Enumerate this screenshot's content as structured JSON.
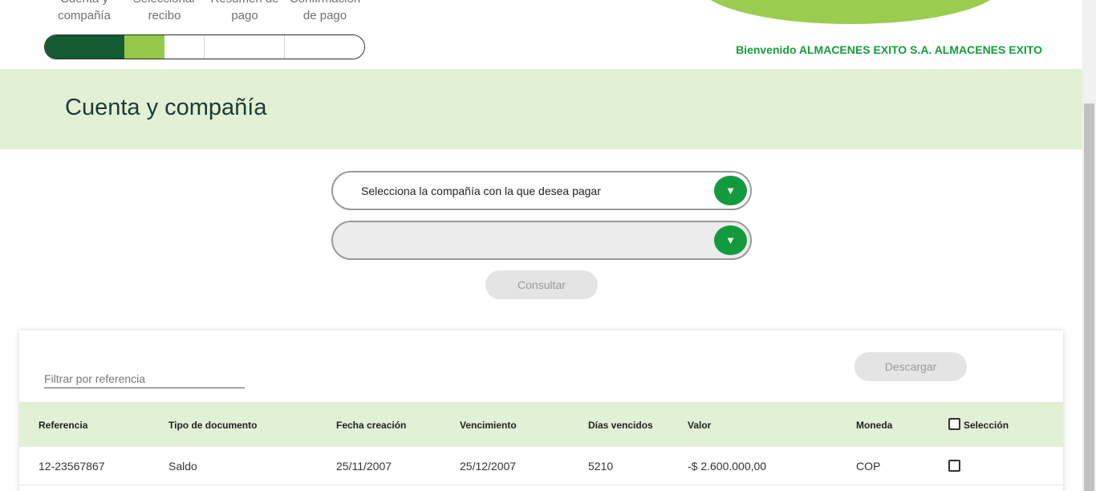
{
  "steps": [
    {
      "label": "Cuenta y compañía"
    },
    {
      "label": "Seleccionar recibo"
    },
    {
      "label": "Resumen de pago"
    },
    {
      "label": "Confirmación de pago"
    }
  ],
  "progress": {
    "completed_steps": 1,
    "active_step": 2,
    "total_steps": 4
  },
  "header": {
    "welcome": "Bienvenido ALMACENES EXITO S.A. ALMACENES EXITO"
  },
  "page_title": "Cuenta y compañía",
  "form": {
    "company_select": {
      "value": "Selecciona la compañía con la que desea pagar"
    },
    "account_select": {
      "value": ""
    },
    "consult_label": "Consultar"
  },
  "table_card": {
    "filter_placeholder": "Filtrar por referencia",
    "download_label": "Descargar",
    "columns": {
      "referencia": "Referencia",
      "tipo": "Tipo de documento",
      "fecha": "Fecha creación",
      "vencimiento": "Vencimiento",
      "dias": "Días vencidos",
      "valor": "Valor",
      "moneda": "Moneda",
      "seleccion": "Selección"
    },
    "rows": [
      {
        "referencia": "12-23567867",
        "tipo": "Saldo",
        "fecha": "25/11/2007",
        "vencimiento": "25/12/2007",
        "dias": "5210",
        "valor": "-$ 2.600.000,00",
        "moneda": "COP",
        "selected": false
      }
    ]
  },
  "icons": {
    "dropdown": "▼"
  },
  "colors": {
    "brand_dark_green": "#145a32",
    "brand_light_green": "#95c84a",
    "accent_green": "#139a3d",
    "band_green": "#e2f1d6",
    "welcome_green": "#139e3a"
  }
}
